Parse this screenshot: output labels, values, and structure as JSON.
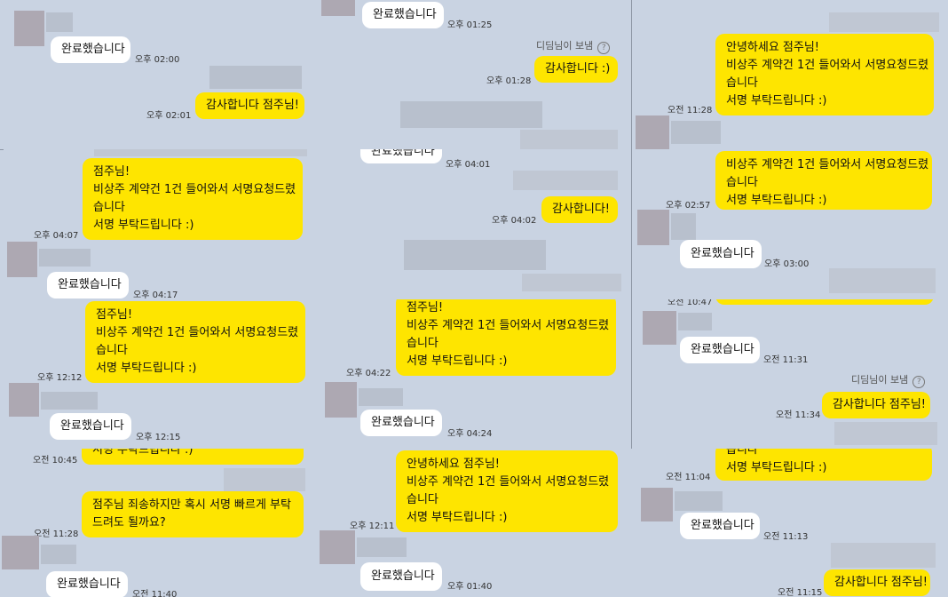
{
  "labels": {
    "done": "완료했습니다",
    "thanks": "감사합니다 :)",
    "thanks_short": "감사합니다!",
    "thanks_owner": "감사합니다 점주님!",
    "sent_by": "디딤님이 보냄",
    "help": "?"
  },
  "request": {
    "greeting": "안녕하세요 점주님!",
    "owner": "점주님!",
    "line1": "비상주 계약건 1건 들어와서 서명요청드렸",
    "line2": "습니다",
    "line3": "서명 부탁드립니다 :)",
    "cut_top": "습니다",
    "cut_bottom_line": "서명 부탁드립니다 :)"
  },
  "urgent": {
    "line1": "점주님 죄송하지만 혹시 서명 빠르게 부탁",
    "line2": "드려도 될까요?"
  },
  "times": {
    "t0200": "오후 02:00",
    "t0201": "오후 02:01",
    "t0407": "오후 04:07",
    "t0417": "오후 04:17",
    "t1212": "오후 12:12",
    "t1215": "오후 12:15",
    "t1045am": "오전 10:45",
    "t1128am": "오전 11:28",
    "t1140am": "오전 11:40",
    "t0125": "오후 01:25",
    "t0128": "오후 01:28",
    "t0401": "오후 04:01",
    "t0402": "오후 04:02",
    "t0422": "오후 04:22",
    "t0424": "오후 04:24",
    "t1211": "오후 12:11",
    "t0140": "오후 01:40",
    "t0257": "오후 02:57",
    "t0300": "오후 03:00",
    "t1047": "오전 10:47",
    "t1131": "오전 11:31",
    "t1134": "오전 11:34",
    "t1104": "오전 11:04",
    "t1113": "오전 11:13",
    "t1115": "오전 11:15"
  }
}
